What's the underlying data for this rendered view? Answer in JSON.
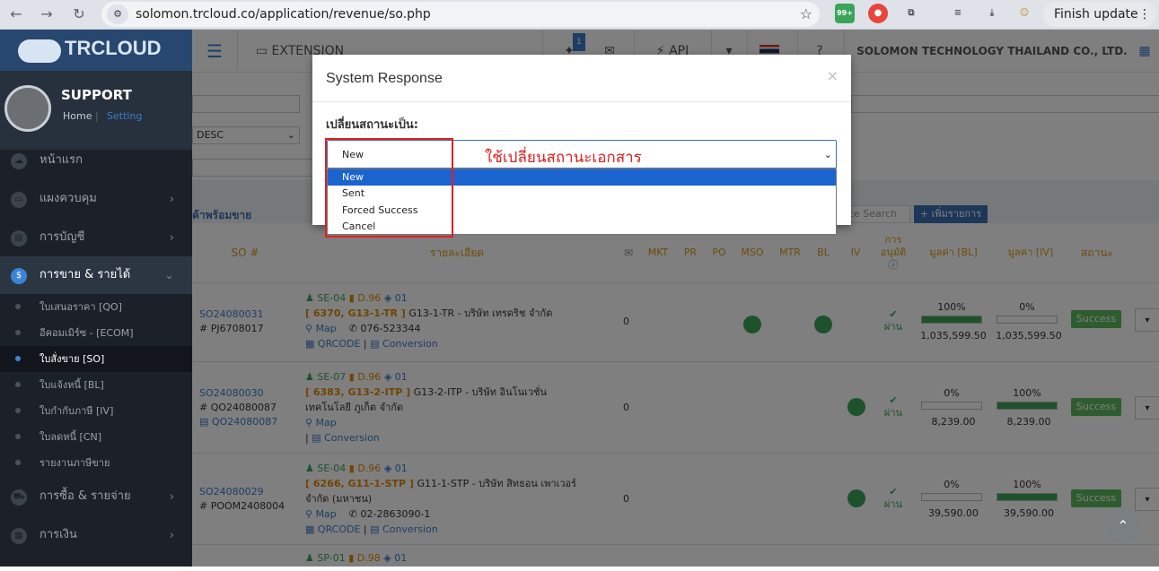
{
  "browser": {
    "url": "solomon.trcloud.co/application/revenue/so.php",
    "badge": "99+",
    "finish_update": "Finish update"
  },
  "sidebar": {
    "logo": "TRCLOUD",
    "user_name": "SUPPORT",
    "home": "Home",
    "setting": "Setting",
    "menu": [
      {
        "label": "หน้าแรก"
      },
      {
        "label": "แผงควบคุม"
      },
      {
        "label": "การบัญชี"
      },
      {
        "label": "การขาย & รายได้"
      },
      {
        "label": "การซื้อ & รายจ่าย"
      },
      {
        "label": "การเงิน"
      }
    ],
    "submenu": [
      {
        "label": "ใบเสนอราคา [QO]"
      },
      {
        "label": "อีคอมเมิร์ซ - [ECOM]"
      },
      {
        "label": "ใบสั่งขาย [SO]"
      },
      {
        "label": "ใบแจ้งหนี้ [BL]"
      },
      {
        "label": "ใบกำกับภาษี [IV]"
      },
      {
        "label": "ใบลดหนี้ [CN]"
      },
      {
        "label": "รายงานภาษีขาย"
      }
    ]
  },
  "header": {
    "extension": "EXTENSION",
    "api": "API",
    "company": "SOLOMON TECHNOLOGY THAILAND CO., LTD.",
    "notif_count": "1"
  },
  "filters": {
    "sort_value": "DESC",
    "list_title": "ค้าพร้อมขาย",
    "search_placeholder": "ce Search",
    "add_button": "+ เพิ่มรายการ"
  },
  "table": {
    "headers": {
      "so": "SO #",
      "detail": "รายละเอียด",
      "mkt": "MKT",
      "pr": "PR",
      "po": "PO",
      "mso": "MSO",
      "mtr": "MTR",
      "bl": "BL",
      "iv": "IV",
      "approve_1": "การ",
      "approve_2": "อนุมัติ",
      "value_bl": "มูลค่า [BL]",
      "value_iv": "มูลค่า [IV]",
      "status": "สถานะ"
    },
    "rows": [
      {
        "so": "SO24080031",
        "ref": "# PJ6708017",
        "ref2": "",
        "sales": "SE-04",
        "doc": "D.96",
        "box": "01",
        "cust": "[ 6370, G13-1-TR ]",
        "cust_name": "G13-1-TR - บริษัท เทรดริช จำกัด",
        "cust_name2": "",
        "map": "Map",
        "phone": "076-523344",
        "qr": "QRCODE",
        "conv": "Conversion",
        "mail": "0",
        "approve": "ผ่าน",
        "bl_pct": "100%",
        "iv_pct": "0%",
        "bl_fill": 1.0,
        "iv_fill": 0.0,
        "bl_val": "1,035,599.50",
        "iv_val": "1,035,599.50",
        "status": "Success"
      },
      {
        "so": "SO24080030",
        "ref": "# QO24080087",
        "ref2": "QO24080087",
        "sales": "SE-07",
        "doc": "D.96",
        "box": "01",
        "cust": "[ 6383, G13-2-ITP ]",
        "cust_name": "G13-2-ITP - บริษัท อินโนเวชั่น",
        "cust_name2": "เทคโนโลยี ภูเก็ต จำกัด",
        "map": "Map",
        "phone": "",
        "qr": "",
        "conv": "Conversion",
        "mail": "0",
        "approve": "ผ่าน",
        "bl_pct": "0%",
        "iv_pct": "100%",
        "bl_fill": 0.0,
        "iv_fill": 1.0,
        "bl_val": "8,239.00",
        "iv_val": "8,239.00",
        "status": "Success"
      },
      {
        "so": "SO24080029",
        "ref": "# POOM2408004",
        "ref2": "",
        "sales": "SE-04",
        "doc": "D.96",
        "box": "01",
        "cust": "[ 6266, G11-1-STP ]",
        "cust_name": "G11-1-STP - บริษัท สิทธอน เพาเวอร์",
        "cust_name2": "จำกัด (มหาชน)",
        "map": "Map",
        "phone": "02-2863090-1",
        "qr": "QRCODE",
        "conv": "Conversion",
        "mail": "0",
        "approve": "ผ่าน",
        "bl_pct": "0%",
        "iv_pct": "100%",
        "bl_fill": 0.0,
        "iv_fill": 1.0,
        "bl_val": "39,590.00",
        "iv_val": "39,590.00",
        "status": "Success"
      },
      {
        "so": "",
        "ref": "",
        "ref2": "",
        "sales": "SP-01",
        "doc": "D.98",
        "box": "01"
      }
    ]
  },
  "modal": {
    "title": "System Response",
    "close": "×",
    "label": "เปลี่ยนสถานะเป็น:",
    "selected": "New",
    "options": [
      "New",
      "Sent",
      "Forced Success",
      "Cancel"
    ],
    "annotation": "ใช้เปลี่ยนสถานะเอกสาร"
  }
}
